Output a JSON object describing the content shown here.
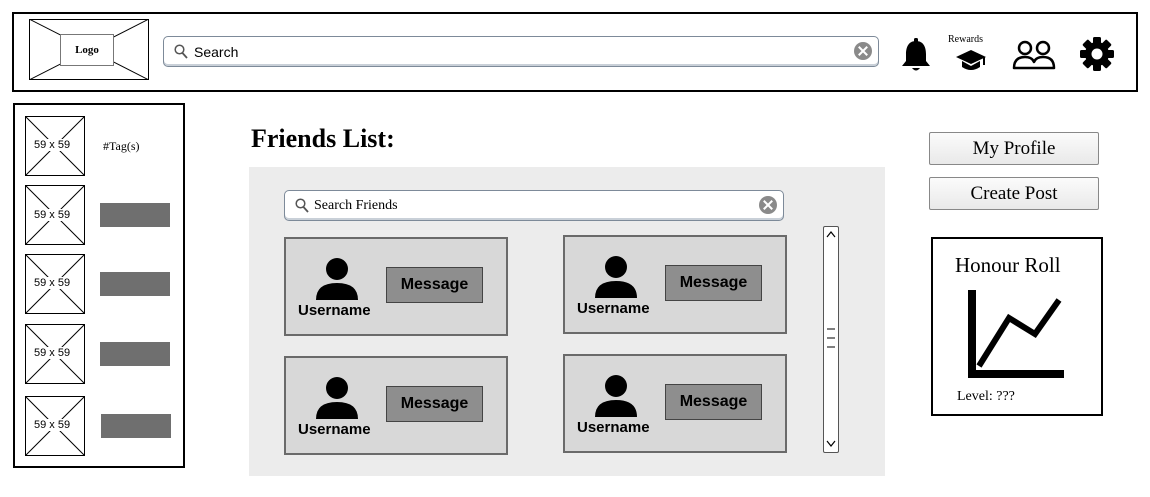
{
  "header": {
    "logo_label": "Logo",
    "search_placeholder": "Search",
    "rewards_label": "Rewards",
    "icons": [
      "bell-icon",
      "graduation-cap-icon",
      "people-icon",
      "gear-icon"
    ]
  },
  "sidebar": {
    "items": [
      {
        "thumb": "59 x 59",
        "tag": "#Tag(s)"
      },
      {
        "thumb": "59 x 59"
      },
      {
        "thumb": "59 x 59"
      },
      {
        "thumb": "59 x 59"
      },
      {
        "thumb": "59 x 59"
      }
    ]
  },
  "main": {
    "title": "Friends List:",
    "search_placeholder": "Search Friends",
    "friends": [
      {
        "username": "Username",
        "action": "Message"
      },
      {
        "username": "Username",
        "action": "Message"
      },
      {
        "username": "Username",
        "action": "Message"
      },
      {
        "username": "Username",
        "action": "Message"
      }
    ]
  },
  "right": {
    "my_profile": "My Profile",
    "create_post": "Create Post",
    "honour_roll_title": "Honour Roll",
    "level_text": "Level: ???"
  },
  "colors": {
    "panel": "#ececec",
    "card": "#d8d8d8",
    "button": "#8e8e8e",
    "tag_bar": "#6f6f6f"
  }
}
